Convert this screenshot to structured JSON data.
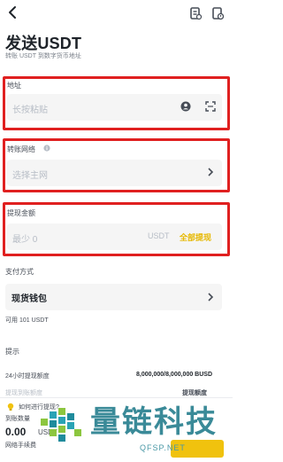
{
  "header": {
    "title": "发送USDT",
    "subtitle": "转账 USDT 到数字货币地址"
  },
  "address": {
    "label": "地址",
    "placeholder": "长按粘贴"
  },
  "network": {
    "label": "转账网络",
    "placeholder": "选择主网"
  },
  "amount": {
    "label": "提现金额",
    "placeholder": "最少 0",
    "unit": "USDT",
    "max_label": "全部提现"
  },
  "payment": {
    "label": "支付方式",
    "value": "现货钱包",
    "available": "可用 101 USDT"
  },
  "tips": {
    "label": "提示",
    "limit_label": "24小时提现额度",
    "limit_value": "8,000,000/8,000,000 BUSD",
    "faded_left": "提现到账额度",
    "faded_right": "提现额度"
  },
  "bottom": {
    "tip_text": "如何进行提现?",
    "receive_label": "到账数量",
    "receive_amount": "0.00",
    "receive_unit": "USDT",
    "fee_label": "网络手续费"
  },
  "watermark": {
    "title": "量链科技",
    "subtitle": "QFSP.NET"
  },
  "colors": {
    "highlight": "#e02020",
    "accent": "#f0c20e",
    "max_text": "#e6b800",
    "watermark": "#3a8a98"
  }
}
